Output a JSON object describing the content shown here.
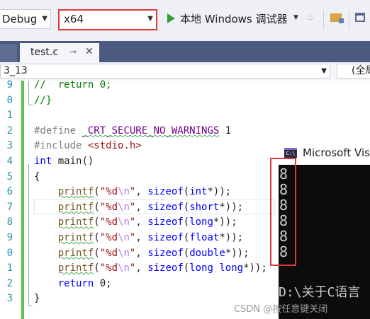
{
  "toolbar": {
    "config": "Debug",
    "platform": "x64",
    "run_label": "本地 Windows 调试器",
    "icons": [
      "run-icon",
      "chevron-down-icon",
      "flame-icon",
      "folder-icon",
      "window-icon"
    ]
  },
  "tab": {
    "filename": "test.c",
    "pin": "⊸",
    "close": "✕"
  },
  "navbar": {
    "scope": "3_13",
    "member": "(全局"
  },
  "editor": {
    "line_numbers": [
      "9",
      "0",
      "1",
      "2",
      "3",
      "4",
      "5",
      "6",
      "7",
      "8",
      "9",
      "0",
      "1",
      "2",
      "3"
    ],
    "lines": [
      "//  return 0;",
      "//}",
      "",
      "#define _CRT_SECURE_NO_WARNINGS 1",
      "#include <stdio.h>",
      "int main()",
      "{",
      "    printf(\"%d\\n\", sizeof(int*));",
      "    printf(\"%d\\n\", sizeof(short*));",
      "    printf(\"%d\\n\", sizeof(long*));",
      "    printf(\"%d\\n\", sizeof(float*));",
      "    printf(\"%d\\n\", sizeof(double*));",
      "    printf(\"%d\\n\", sizeof(long long*));",
      "    return 0;",
      "}"
    ]
  },
  "console": {
    "title": "Microsoft Vis",
    "icon_text": "C:\\",
    "output": [
      "8",
      "8",
      "8",
      "8",
      "8",
      "8"
    ],
    "prompt": "D:\\关于C语言"
  },
  "watermark": "CSDN @按任意键关闭"
}
